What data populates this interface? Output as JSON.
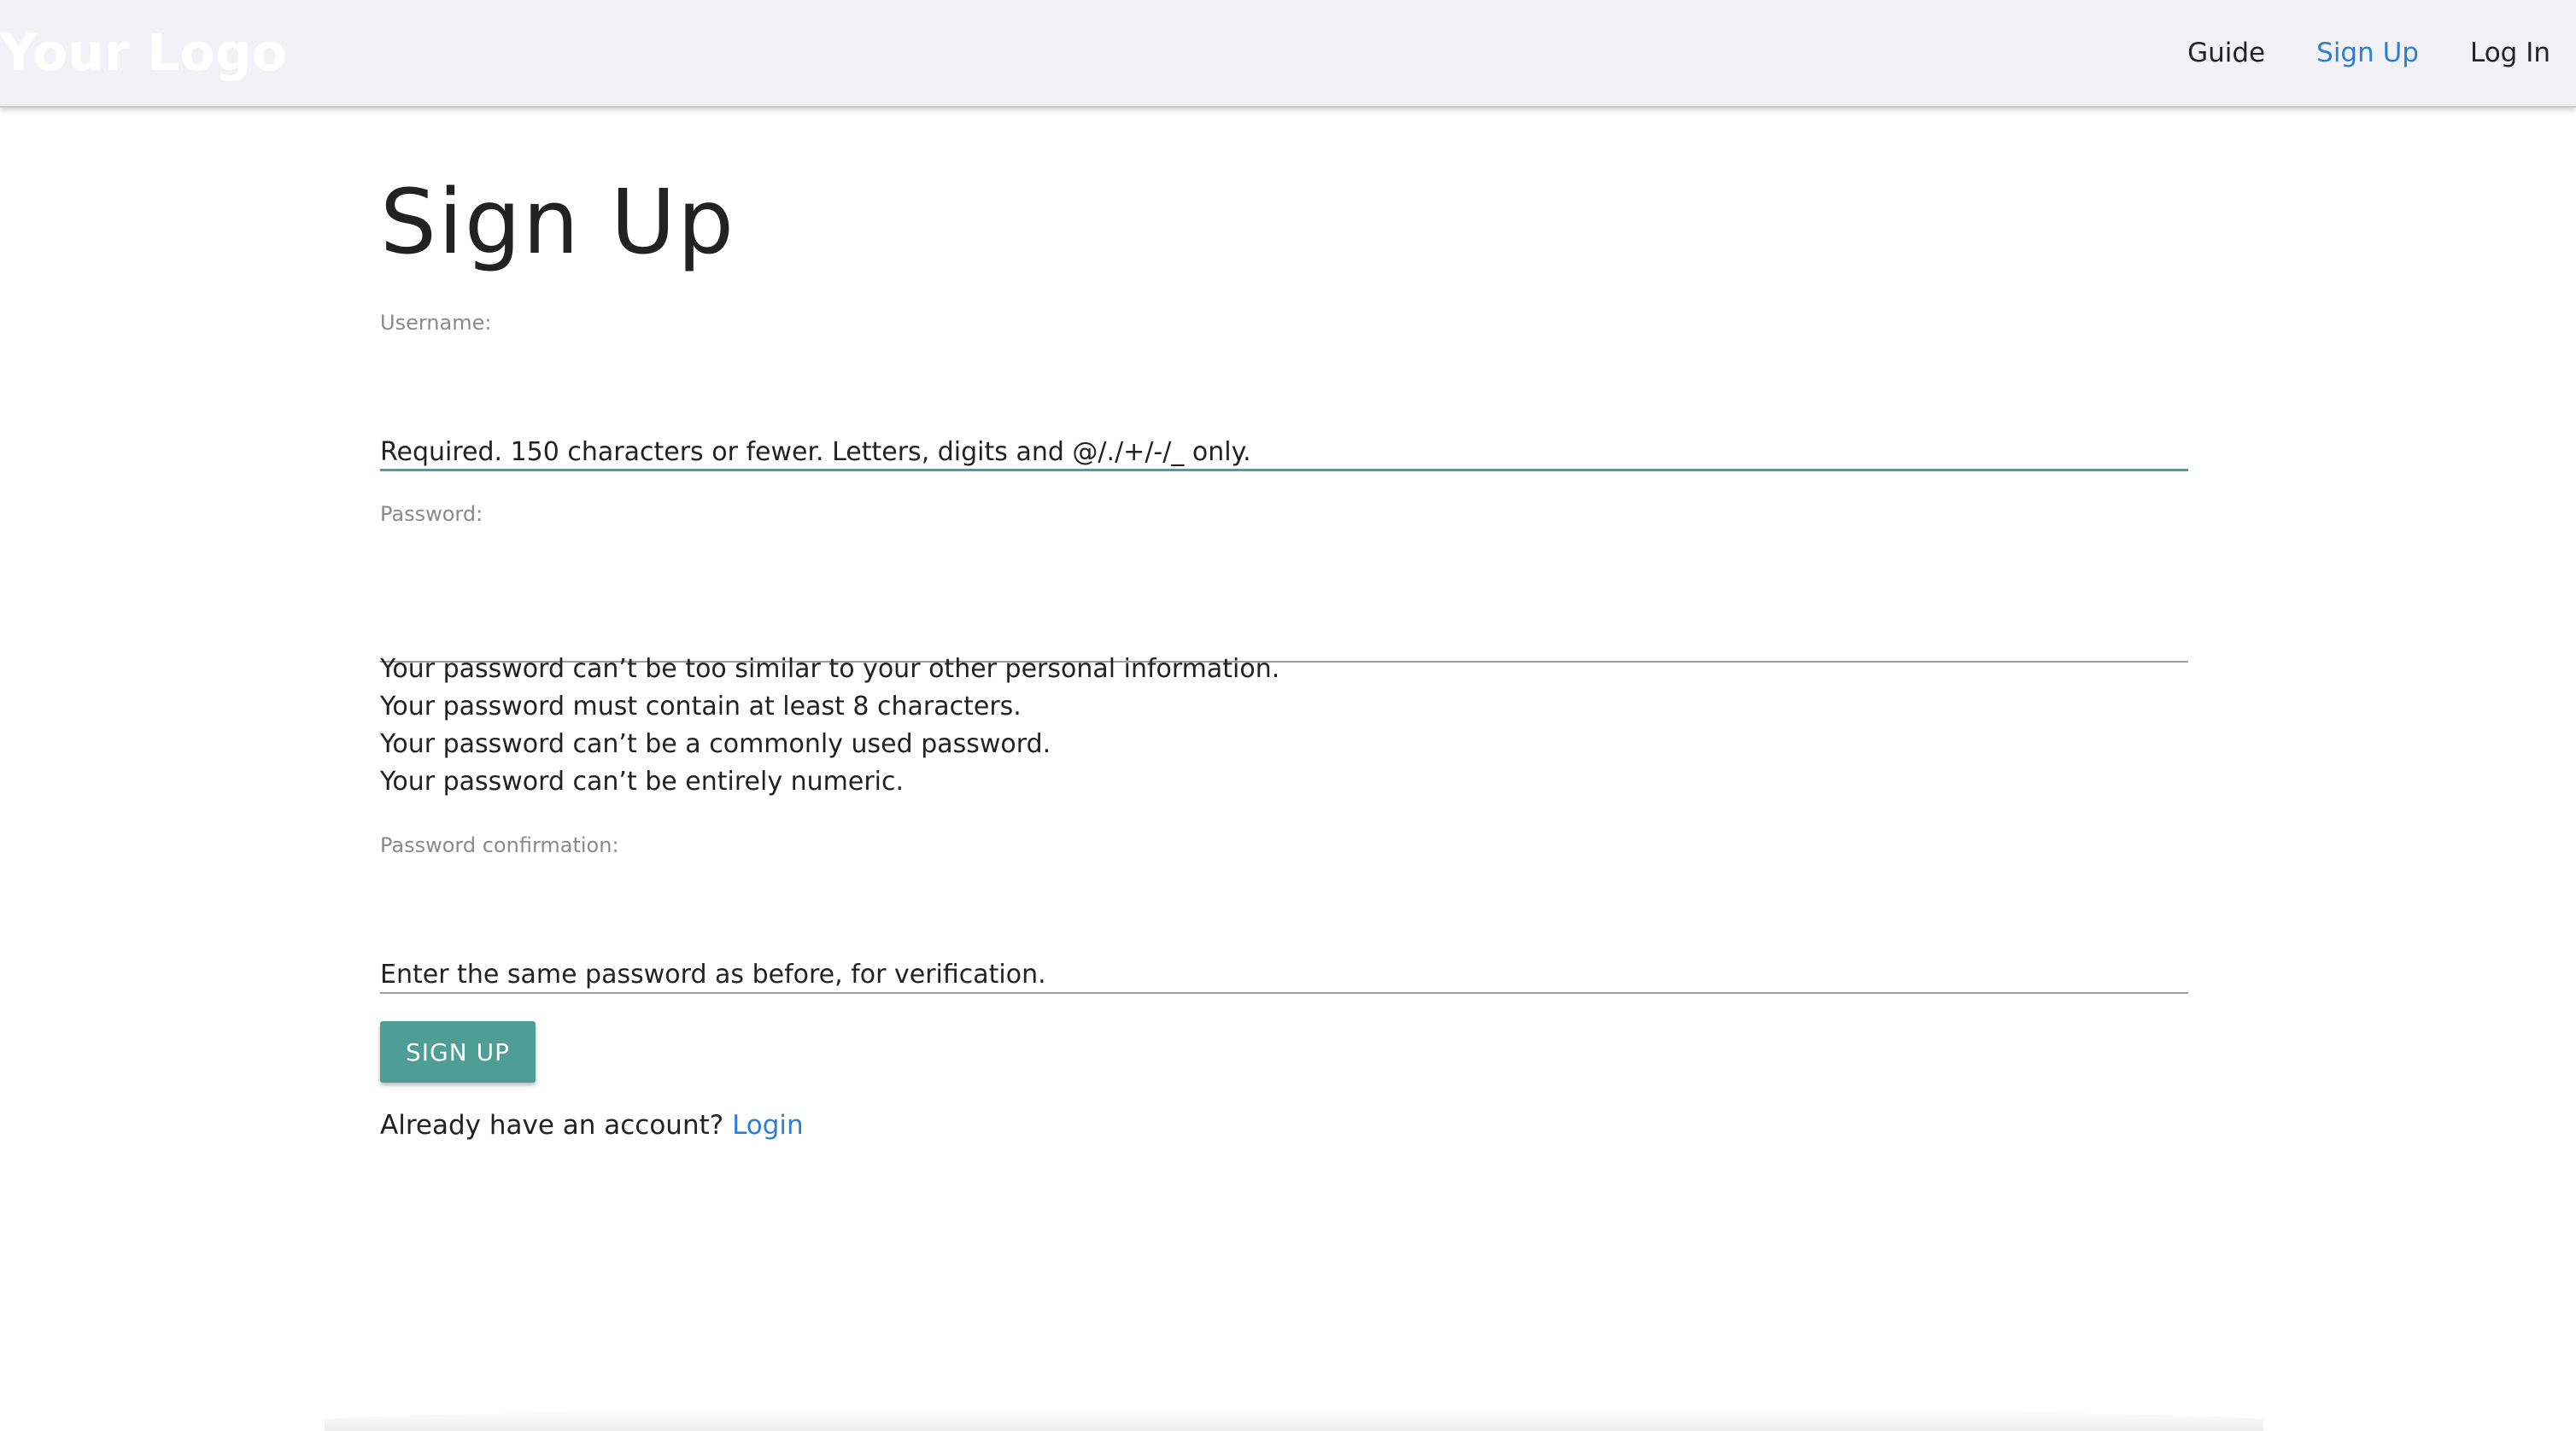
{
  "header": {
    "logo_text": "Your Logo",
    "nav": [
      {
        "label": "Guide"
      },
      {
        "label": "Sign Up"
      },
      {
        "label": "Log In"
      }
    ]
  },
  "form": {
    "title": "Sign Up",
    "username": {
      "label": "Username:",
      "value": "",
      "help": "Required. 150 characters or fewer. Letters, digits and @/./+/-/_ only."
    },
    "password": {
      "label": "Password:",
      "value": "",
      "help": [
        "Your password can’t be too similar to your other personal information.",
        "Your password must contain at least 8 characters.",
        "Your password can’t be a commonly used password.",
        "Your password can’t be entirely numeric."
      ]
    },
    "password_confirmation": {
      "label": "Password confirmation:",
      "value": "",
      "help": "Enter the same password as before, for verification."
    },
    "submit_label": "SIGN UP",
    "account_prompt": "Already have an account?",
    "login_link": "Login"
  },
  "colors": {
    "accent": "#4e9e95",
    "link": "#2b7fd6",
    "header_bg": "#f2f2f6"
  }
}
